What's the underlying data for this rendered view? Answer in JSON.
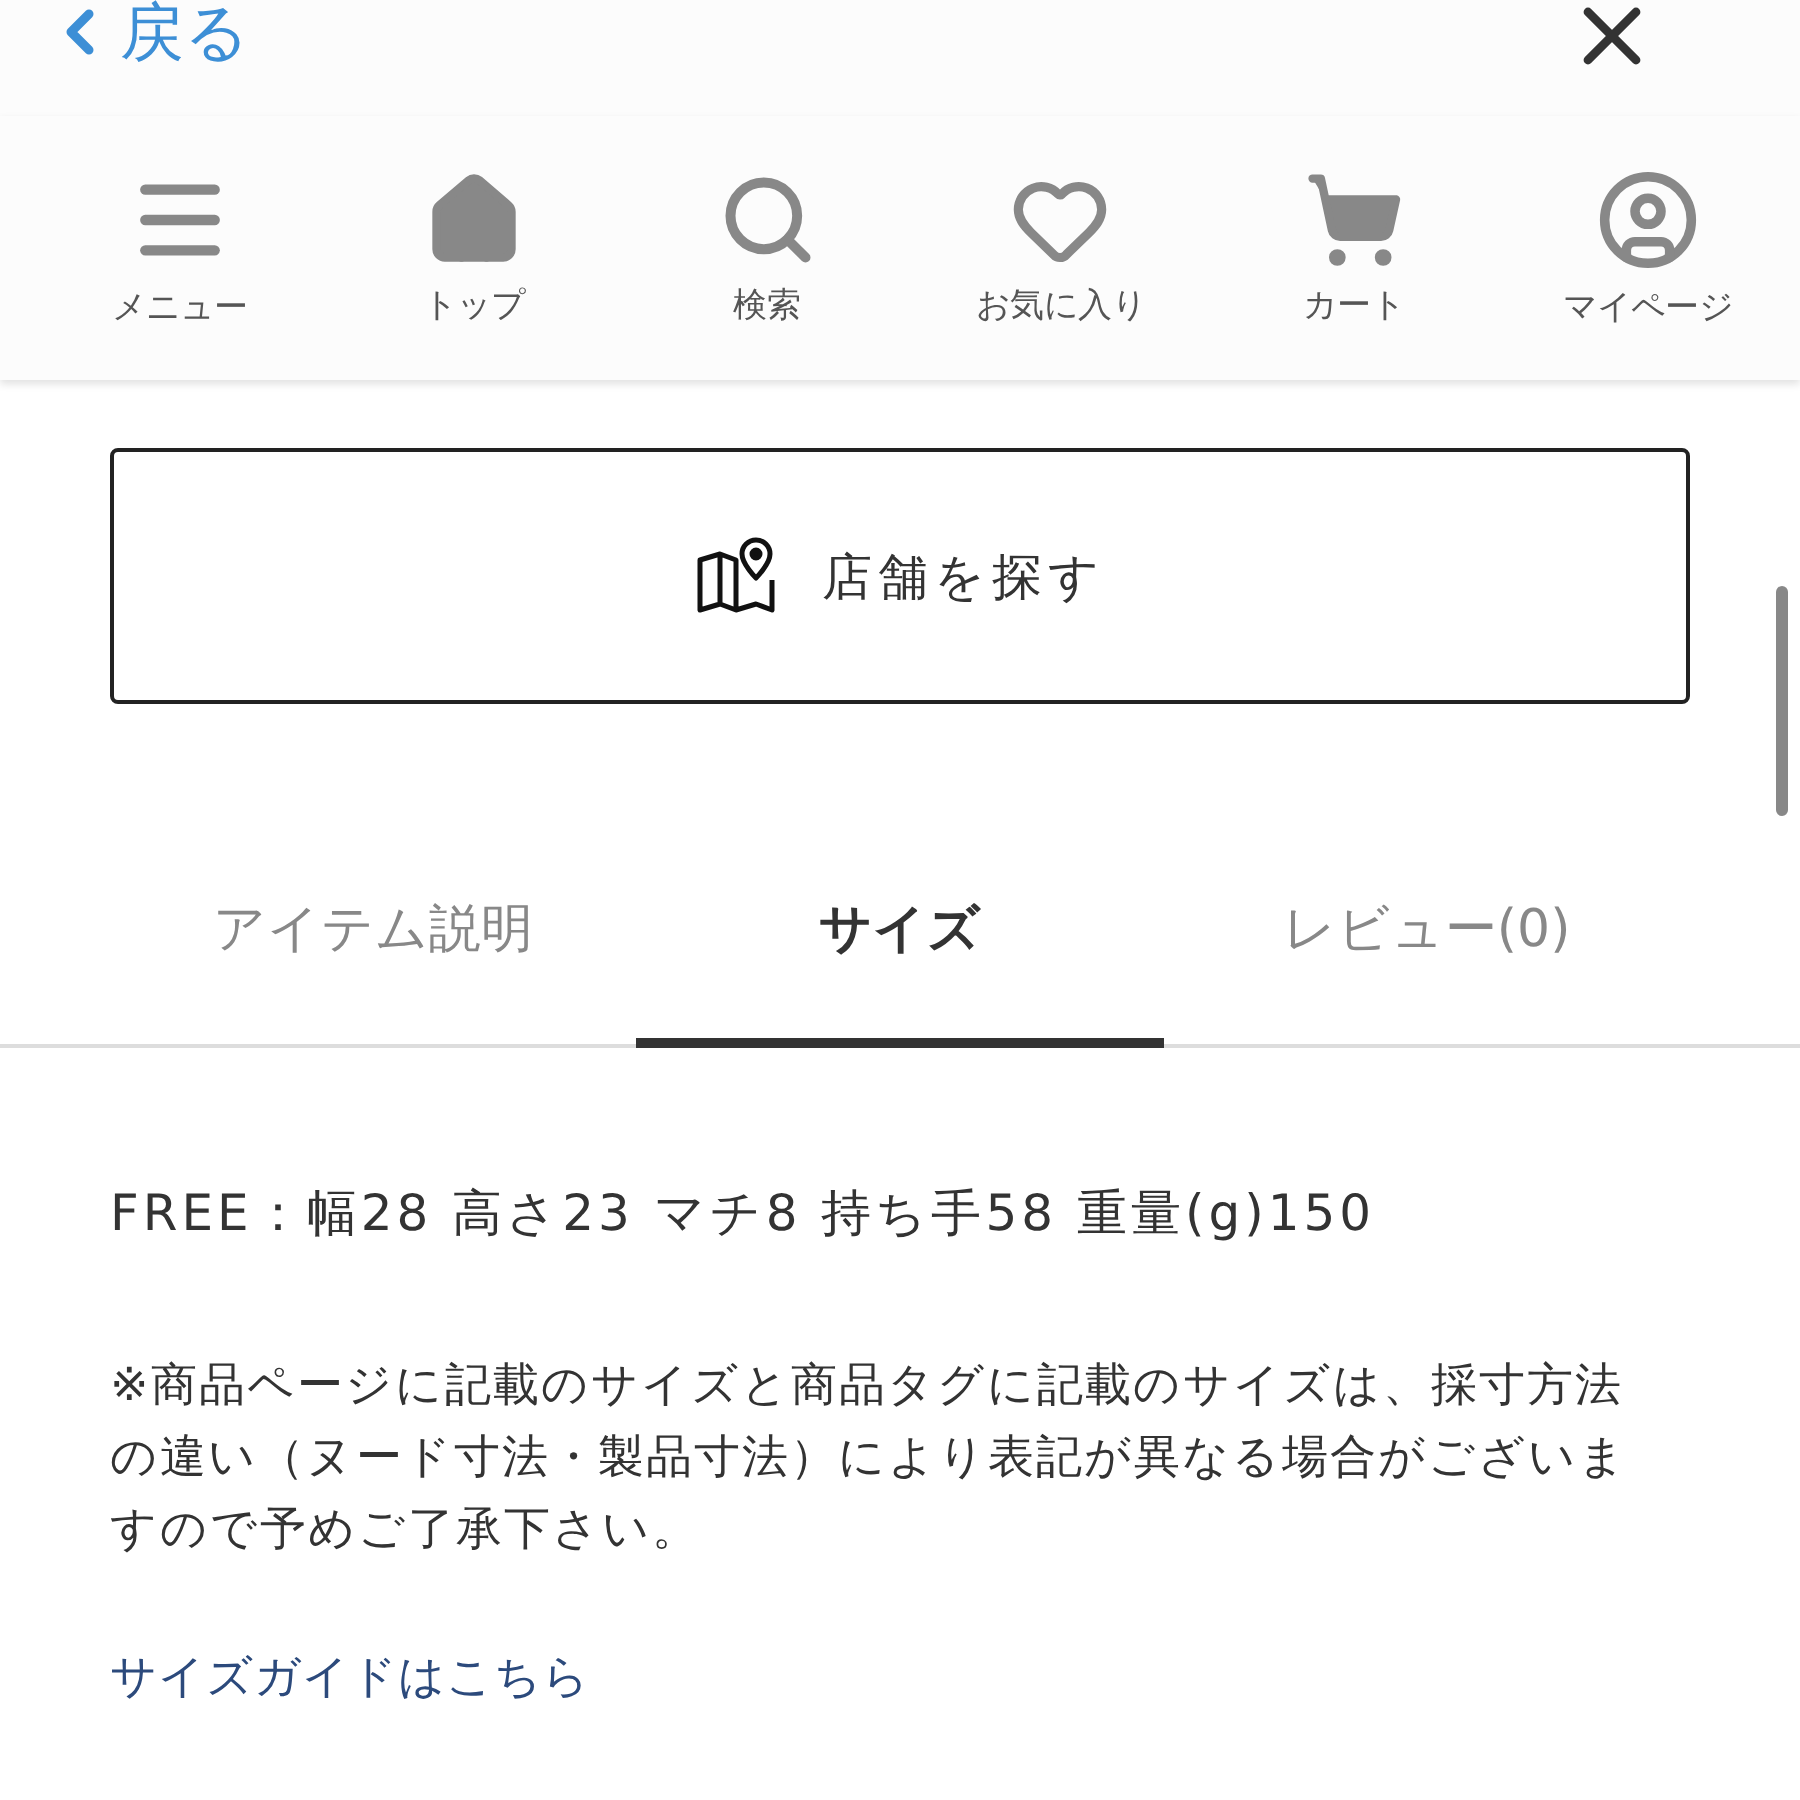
{
  "header": {
    "back": {
      "label": "戻る"
    }
  },
  "nav": [
    {
      "kind": "menu",
      "label": "メニュー"
    },
    {
      "kind": "home",
      "label": "トップ"
    },
    {
      "kind": "search",
      "label": "検索"
    },
    {
      "kind": "heart",
      "label": "お気に入り"
    },
    {
      "kind": "cart",
      "label": "カート"
    },
    {
      "kind": "user",
      "label": "マイページ"
    }
  ],
  "store_button": {
    "label": "店舗を探す"
  },
  "tabs": [
    {
      "label": "アイテム説明",
      "selected": false
    },
    {
      "label": "サイズ",
      "selected": true
    },
    {
      "label": "レビュー(0)",
      "selected": false
    }
  ],
  "size_spec": "FREE：幅28 高さ23 マチ8 持ち手58 重量(g)150",
  "note": "※商品ページに記載のサイズと商品タグに記載のサイズは、採寸方法の違い（ヌード寸法・製品寸法）により表記が異なる場合がございますので予めご了承下さい。",
  "size_guide_link": "サイズガイドはこちら"
}
